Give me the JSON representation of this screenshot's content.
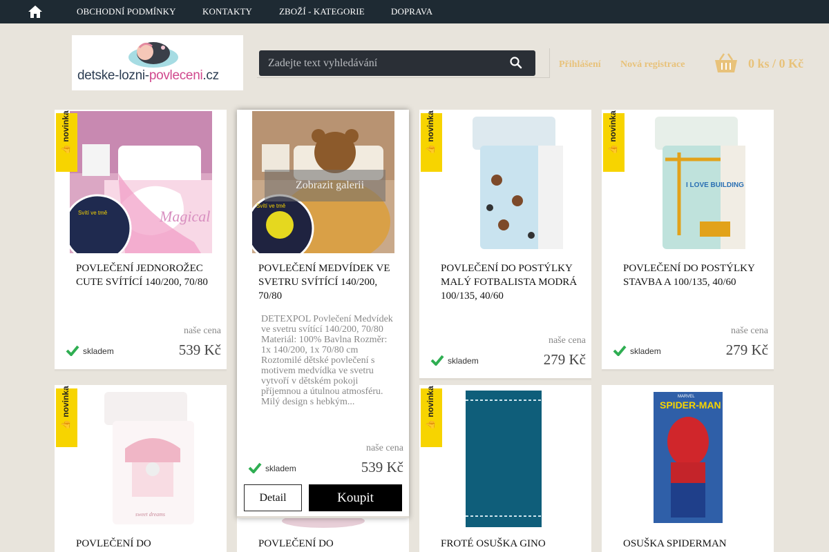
{
  "nav": {
    "items": [
      "OBCHODNÍ PODMÍNKY",
      "KONTAKTY",
      "ZBOŽÍ - KATEGORIE",
      "DOPRAVA"
    ]
  },
  "header": {
    "logo_text_dark": "detske-lozni-",
    "logo_text_pink": "povleceni",
    "logo_text_tld": ".cz",
    "search_placeholder": "Zadejte text vyhledávání",
    "login": "Přihlášení",
    "register": "Nová registrace",
    "cart": "0 ks / 0 Kč"
  },
  "colors": {
    "nav_bg": "#1e2a33",
    "badge": "#f7d400",
    "link": "#e8c27a",
    "check": "#2fae52"
  },
  "labels": {
    "badge": "novinka",
    "our_price": "naše cena",
    "in_stock": "skladem",
    "detail": "Detail",
    "buy": "Koupit",
    "gallery": "Zobrazit galerii"
  },
  "products": [
    {
      "title": "POVLEČENÍ JEDNOROŽEC CUTE SVÍTÍCÍ 140/200, 70/80",
      "price": "539 Kč",
      "badge": true,
      "image": "unicorn-bedding",
      "image_text": "Svítí ve tmě",
      "image_text2": "Magical"
    },
    {
      "title": "POVLEČENÍ MEDVÍDEK VE SVETRU SVÍTÍCÍ 140/200, 70/80",
      "price": "539 Kč",
      "badge": false,
      "image": "teddy-bear-bedding",
      "image_text": "Svítí ve tmě",
      "description": "DETEXPOL Povlečení Medvídek ve svetru svítící 140/200, 70/80 Materiál: 100% Bavlna Rozměr: 1x 140/200, 1x 70/80 cm Roztomilé dětské povlečení s motivem medvídka ve svetru vytvoří v dětském pokoji příjemnou a útulnou atmosféru. Milý design s hebkým..."
    },
    {
      "title": "POVLEČENÍ DO POSTÝLKY MALÝ FOTBALISTA MODRÁ 100/135, 40/60",
      "price": "279 Kč",
      "badge": true,
      "image": "football-crib-bedding"
    },
    {
      "title": "POVLEČENÍ DO POSTÝLKY STAVBA A 100/135, 40/60",
      "price": "279 Kč",
      "badge": true,
      "image": "construction-crib-bedding",
      "image_text": "I LOVE BUILDING"
    },
    {
      "title": "POVLEČENÍ DO",
      "badge": true,
      "image": "carousel-crib-bedding",
      "image_text": "sweet dreams"
    },
    {
      "title": "POVLEČENÍ DO",
      "badge": false,
      "image": "partial-image"
    },
    {
      "title": "FROTÉ OSUŠKA GINO",
      "badge": true,
      "image": "blue-towel"
    },
    {
      "title": "OSUŠKA SPIDERMAN",
      "badge": false,
      "image": "spiderman-towel",
      "image_text": "SPIDER-MAN",
      "image_text2": "MARVEL"
    }
  ]
}
